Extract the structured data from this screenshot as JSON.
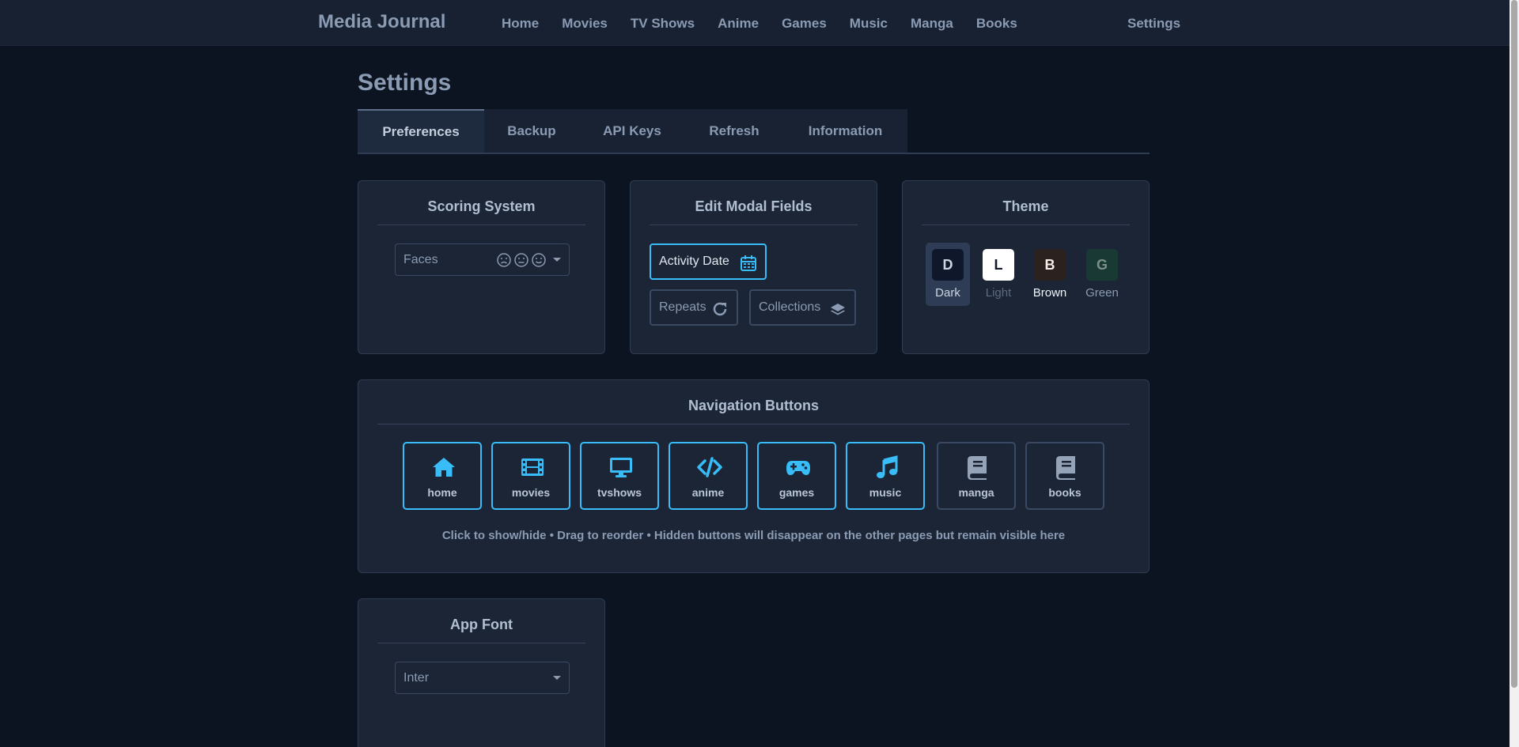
{
  "header": {
    "brand": "Media Journal",
    "links": [
      "Home",
      "Movies",
      "TV Shows",
      "Anime",
      "Games",
      "Music",
      "Manga",
      "Books"
    ],
    "settings": "Settings"
  },
  "page": {
    "title": "Settings",
    "tabs": [
      "Preferences",
      "Backup",
      "API Keys",
      "Refresh",
      "Information"
    ],
    "active_tab": "Preferences"
  },
  "scoring": {
    "title": "Scoring System",
    "selected": "Faces",
    "faces_icons": [
      "sad-face-icon",
      "neutral-face-icon",
      "happy-face-icon"
    ]
  },
  "edit_modal": {
    "title": "Edit Modal Fields",
    "fields": [
      {
        "label": "Activity Date",
        "icon": "calendar-icon",
        "enabled": true
      },
      {
        "label": "Repeats",
        "icon": "refresh-icon",
        "enabled": false
      },
      {
        "label": "Collections",
        "icon": "layers-icon",
        "enabled": false
      }
    ]
  },
  "theme": {
    "title": "Theme",
    "options": [
      {
        "letter": "D",
        "label": "Dark",
        "bg": "#0f172a",
        "fg": "#cbd5e1",
        "label_color": "#cbd5e1",
        "selected": true
      },
      {
        "letter": "L",
        "label": "Light",
        "bg": "#ffffff",
        "fg": "#111827",
        "label_color": "#5b6b82",
        "selected": false
      },
      {
        "letter": "B",
        "label": "Brown",
        "bg": "#2b2220",
        "fg": "#f5ede6",
        "label_color": "#f1f5f9",
        "selected": false
      },
      {
        "letter": "G",
        "label": "Green",
        "bg": "#193a34",
        "fg": "#7c8f88",
        "label_color": "#8a9bb3",
        "selected": false
      }
    ]
  },
  "navigation_buttons": {
    "title": "Navigation Buttons",
    "buttons": [
      {
        "label": "home",
        "icon": "home-icon",
        "visible": true
      },
      {
        "label": "movies",
        "icon": "film-icon",
        "visible": true
      },
      {
        "label": "tvshows",
        "icon": "tv-icon",
        "visible": true
      },
      {
        "label": "anime",
        "icon": "code-icon",
        "visible": true
      },
      {
        "label": "games",
        "icon": "gamepad-icon",
        "visible": true
      },
      {
        "label": "music",
        "icon": "music-note-icon",
        "visible": true
      },
      {
        "label": "manga",
        "icon": "book-icon",
        "visible": false
      },
      {
        "label": "books",
        "icon": "book-icon",
        "visible": false
      }
    ],
    "hint": "Click to show/hide • Drag to reorder • Hidden buttons will disappear on the other pages but remain visible here"
  },
  "app_font": {
    "title": "App Font",
    "selected": "Inter"
  },
  "colors": {
    "accent": "#38bdf8",
    "background": "#0d1421",
    "card": "#1b2536"
  }
}
